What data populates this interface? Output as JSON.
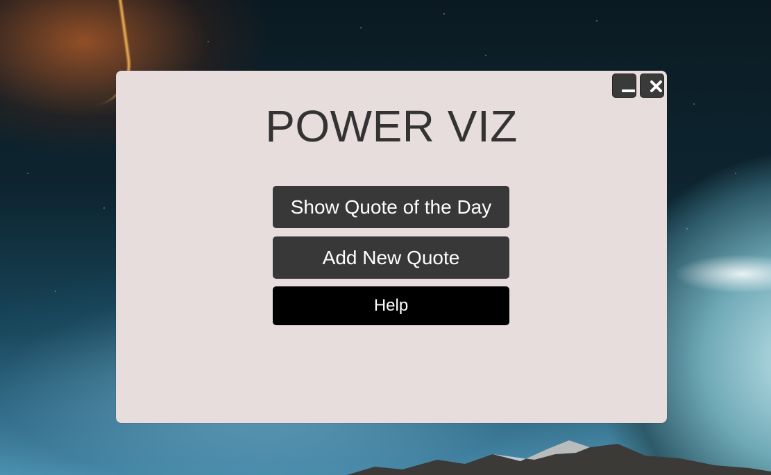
{
  "app": {
    "title": "POWER VIZ"
  },
  "window_controls": {
    "minimize_icon": "minimize-icon",
    "close_icon": "close-icon"
  },
  "menu": {
    "buttons": [
      {
        "label": "Show Quote of the Day"
      },
      {
        "label": "Add New Quote"
      },
      {
        "label": "Help"
      }
    ]
  },
  "colors": {
    "dialog_background": "#e8dddd",
    "button_dark": "#383838",
    "button_help": "#000000",
    "title_text": "#333333"
  }
}
